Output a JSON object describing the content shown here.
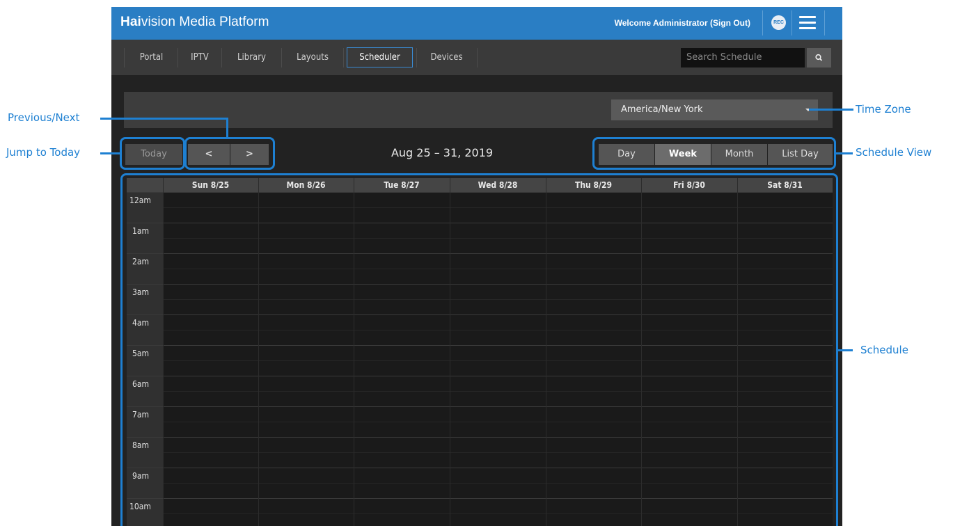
{
  "header": {
    "brand_bold": "Hai",
    "brand_rest": "vision Media Platform",
    "welcome": "Welcome Administrator  (Sign Out)",
    "rec_label": "REC",
    "accent_color": "#2a7ec4"
  },
  "nav": {
    "items": [
      "Portal",
      "IPTV",
      "Library",
      "Layouts",
      "Scheduler",
      "Devices"
    ],
    "active": "Scheduler",
    "search_placeholder": "Search Schedule"
  },
  "timezone": {
    "value": "America/New York"
  },
  "toolbar": {
    "today_label": "Today",
    "prev_label": "<",
    "next_label": ">",
    "date_range": "Aug 25 – 31, 2019",
    "views": [
      "Day",
      "Week",
      "Month",
      "List Day"
    ],
    "active_view": "Week"
  },
  "calendar": {
    "days": [
      "Sun 8/25",
      "Mon 8/26",
      "Tue 8/27",
      "Wed 8/28",
      "Thu 8/29",
      "Fri 8/30",
      "Sat 8/31"
    ],
    "hours": [
      "12am",
      "1am",
      "2am",
      "3am",
      "4am",
      "5am",
      "6am",
      "7am",
      "8am",
      "9am",
      "10am"
    ]
  },
  "annotations": {
    "previous_next": "Previous/Next",
    "jump_to_today": "Jump to Today",
    "time_zone": "Time Zone",
    "schedule_view": "Schedule View",
    "schedule": "Schedule",
    "color": "#1e80d2"
  }
}
